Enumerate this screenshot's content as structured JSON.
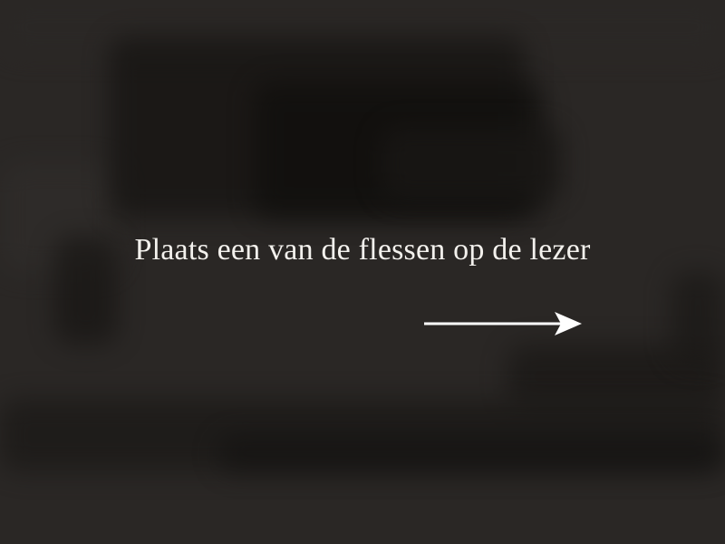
{
  "instruction": {
    "text": "Plaats een van de flessen op de lezer"
  },
  "arrow": {
    "icon": "arrow-right-icon",
    "color": "#ffffff"
  },
  "background": {
    "base_color": "#2a2725"
  }
}
